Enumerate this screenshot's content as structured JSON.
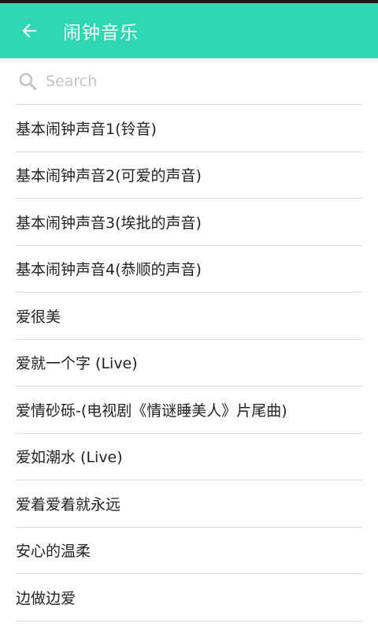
{
  "header": {
    "title": "闹钟音乐"
  },
  "search": {
    "placeholder": "Search"
  },
  "list": {
    "items": [
      "基本闹钟声音1(铃音)",
      "基本闹钟声音2(可爱的声音)",
      "基本闹钟声音3(埃批的声音)",
      "基本闹钟声音4(恭顺的声音)",
      "爱很美",
      "爱就一个字 (Live)",
      "爱情砂砾-(电视剧《情谜睡美人》片尾曲)",
      "爱如潮水 (Live)",
      "爱着爱着就永远",
      "安心的温柔",
      "边做边爱"
    ]
  },
  "colors": {
    "accent": "#2fd8b3"
  }
}
